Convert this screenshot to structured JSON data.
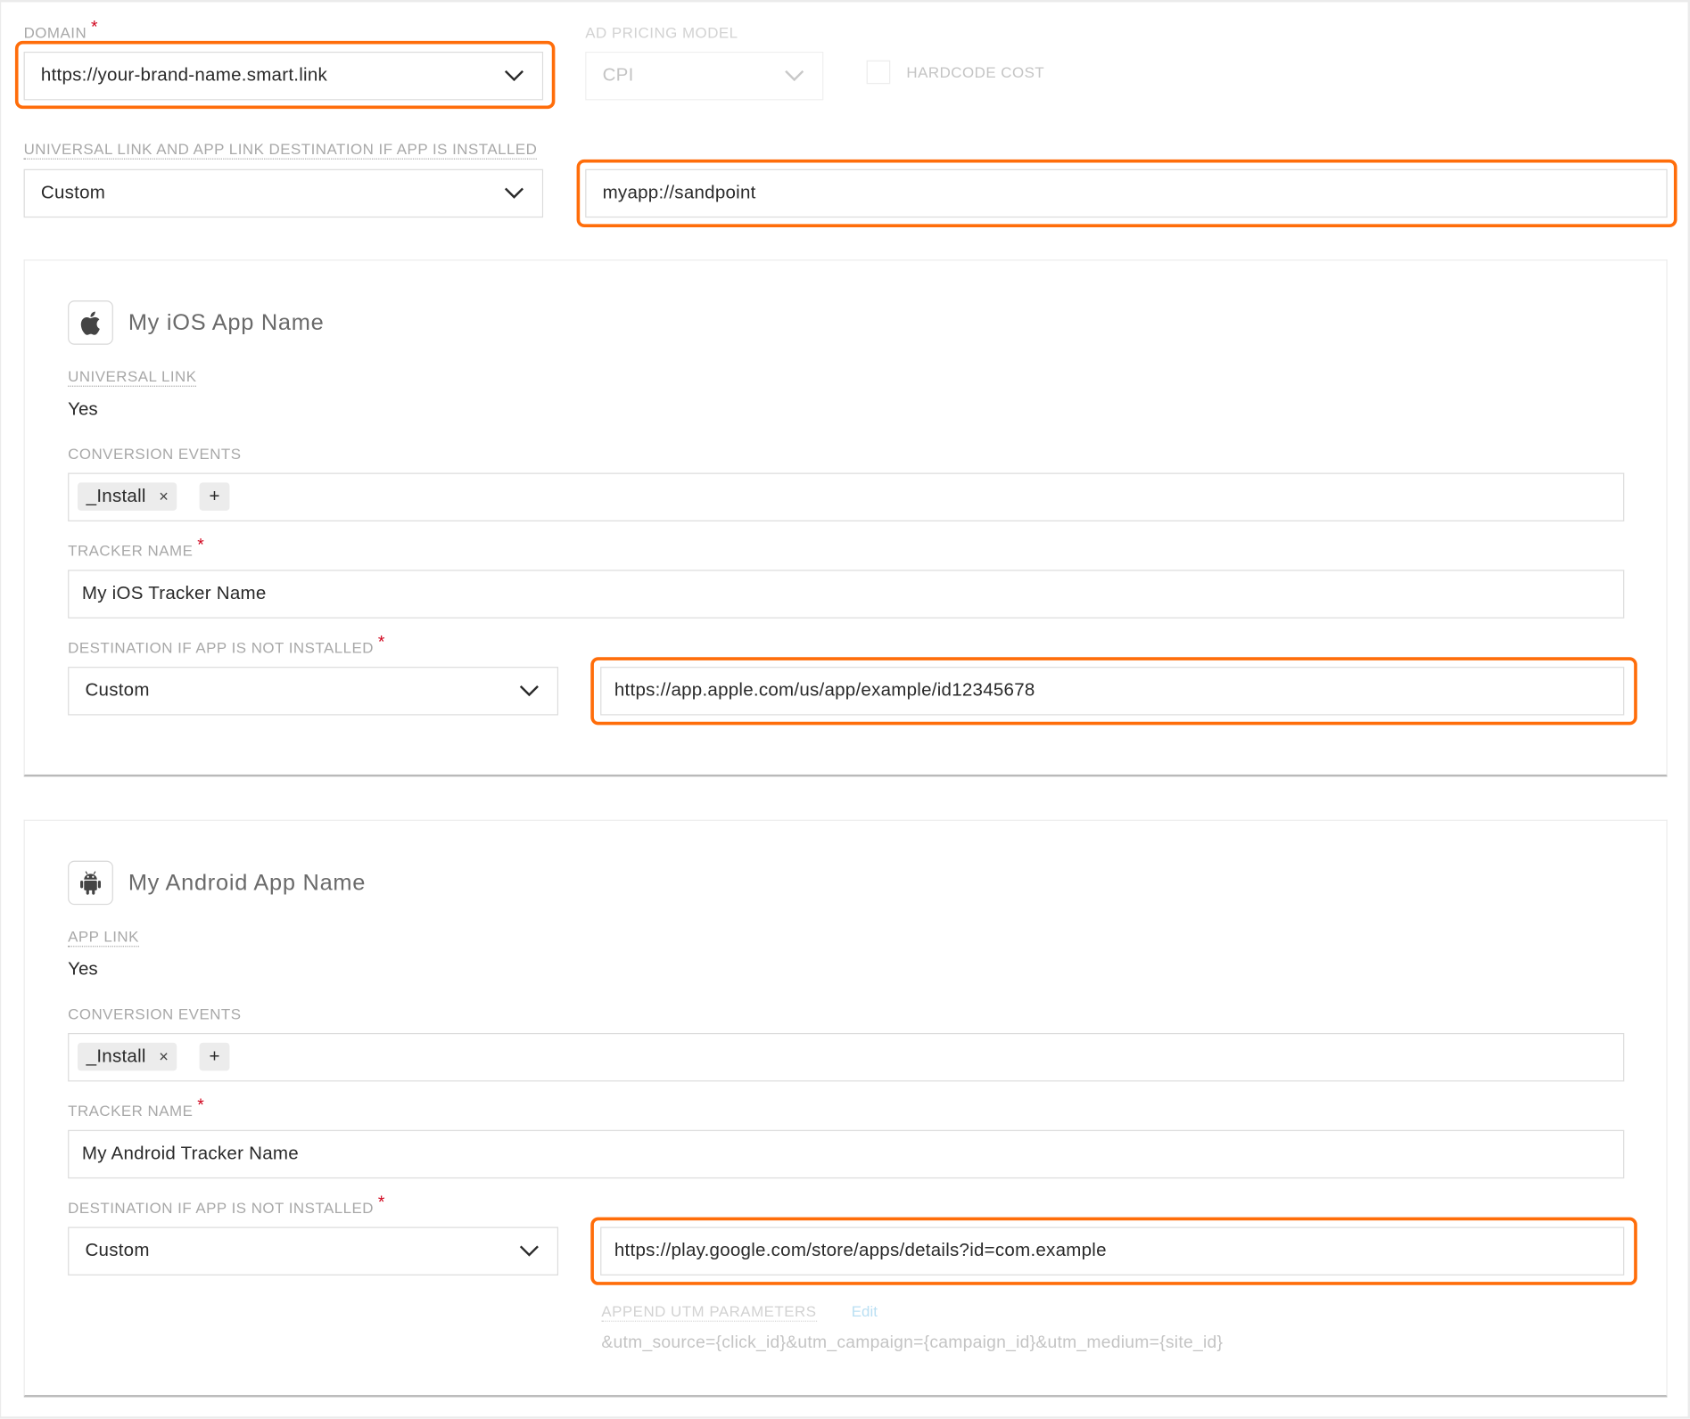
{
  "top": {
    "domain": {
      "label": "DOMAIN",
      "required_mark": "*",
      "value": "https://your-brand-name.smart.link",
      "icon": "chevron-down-icon",
      "highlighted": true
    },
    "ad_pricing_model": {
      "label": "AD PRICING MODEL",
      "value": "CPI",
      "disabled": true,
      "icon": "chevron-down-icon"
    },
    "hardcode_cost": {
      "label": "HARDCODE COST",
      "checked": false,
      "disabled": true
    },
    "universal_link_destination": {
      "label": "UNIVERSAL LINK AND APP LINK DESTINATION IF APP IS INSTALLED",
      "select_value": "Custom",
      "input_value": "myapp://sandpoint",
      "input_highlighted": true
    }
  },
  "apps": [
    {
      "platform_icon": "apple-icon",
      "name": "My iOS App Name",
      "link_label": "UNIVERSAL LINK",
      "link_value": "Yes",
      "conversion_events_label": "CONVERSION EVENTS",
      "conversion_events": [
        "_Install"
      ],
      "remove_glyph": "×",
      "add_glyph": "+",
      "tracker_name_label": "TRACKER NAME",
      "required_mark": "*",
      "tracker_name": "My iOS Tracker Name",
      "destination_label": "DESTINATION IF APP IS NOT INSTALLED",
      "destination_select": "Custom",
      "destination_url": "https://app.apple.com/us/app/example/id12345678",
      "destination_url_highlighted": true
    },
    {
      "platform_icon": "android-icon",
      "name": "My Android App Name",
      "link_label": "APP LINK",
      "link_value": "Yes",
      "conversion_events_label": "CONVERSION EVENTS",
      "conversion_events": [
        "_Install"
      ],
      "remove_glyph": "×",
      "add_glyph": "+",
      "tracker_name_label": "TRACKER NAME",
      "required_mark": "*",
      "tracker_name": "My Android Tracker Name",
      "destination_label": "DESTINATION IF APP IS NOT INSTALLED",
      "destination_select": "Custom",
      "destination_url": "https://play.google.com/store/apps/details?id=com.example",
      "destination_url_highlighted": true,
      "utm": {
        "label": "APPEND UTM PARAMETERS",
        "edit_label": "Edit",
        "value": "&utm_source={click_id}&utm_campaign={campaign_id}&utm_medium={site_id}"
      }
    }
  ],
  "colors": {
    "highlight": "#ff6d0a",
    "required": "#d0021b",
    "label": "#a8a8a8",
    "link": "#b9dff3"
  }
}
